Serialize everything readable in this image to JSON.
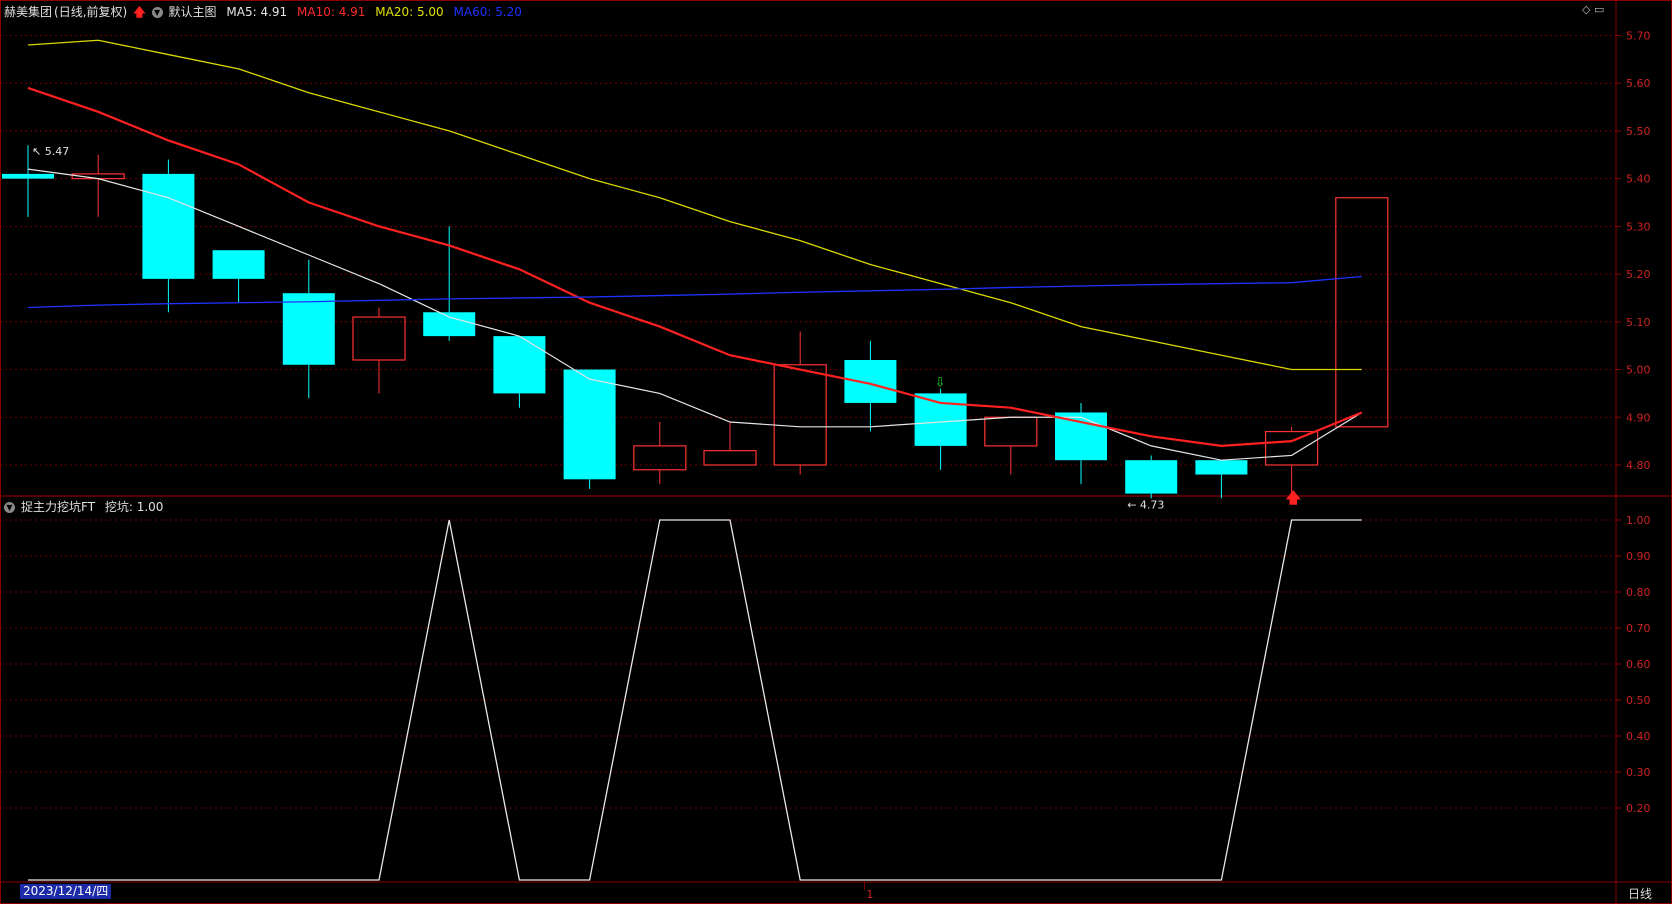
{
  "header": {
    "stock_name": "赫美集团",
    "period_mode": "(日线,前复权)",
    "main_chart_label": "默认主图",
    "ma_labels": [
      {
        "text": "MA5: 4.91",
        "color": "#e6e6e6"
      },
      {
        "text": "MA10: 4.91",
        "color": "#ff2a2a"
      },
      {
        "text": "MA20: 5.00",
        "color": "#e0e000"
      },
      {
        "text": "MA60: 5.20",
        "color": "#1e32ff"
      }
    ]
  },
  "indicator": {
    "title": "捉主力挖坑FT",
    "value_label": "挖坑: 1.00"
  },
  "footer": {
    "date_cursor": "2023/12/14/四",
    "month_marker": "1",
    "period_button": "日线"
  },
  "colors": {
    "up": "#ff3232",
    "down": "#00ffff",
    "grid": "#8b0000",
    "axis_text": "#cc2222",
    "ma5": "#e6e6e6",
    "ma10": "#ff2020",
    "ma20": "#d8d800",
    "ma60": "#1e32ff",
    "indicator_line": "#e8e8e8"
  },
  "chart_data": [
    {
      "type": "candlestick",
      "y_ticks": [
        "5.70",
        "5.60",
        "5.50",
        "5.40",
        "5.30",
        "5.20",
        "5.10",
        "5.00",
        "4.90",
        "4.80"
      ],
      "ylim": [
        4.735,
        5.745
      ],
      "annotations": [
        {
          "text": "5.47",
          "index": 0
        },
        {
          "text": "4.73",
          "index": 16
        }
      ],
      "candles": [
        {
          "open": 5.41,
          "high": 5.47,
          "low": 5.32,
          "close": 5.4
        },
        {
          "open": 5.4,
          "high": 5.45,
          "low": 5.32,
          "close": 5.41
        },
        {
          "open": 5.41,
          "high": 5.44,
          "low": 5.12,
          "close": 5.19
        },
        {
          "open": 5.25,
          "high": 5.25,
          "low": 5.14,
          "close": 5.19
        },
        {
          "open": 5.16,
          "high": 5.23,
          "low": 4.94,
          "close": 5.01
        },
        {
          "open": 5.02,
          "high": 5.13,
          "low": 4.95,
          "close": 5.11
        },
        {
          "open": 5.12,
          "high": 5.3,
          "low": 5.06,
          "close": 5.07
        },
        {
          "open": 5.07,
          "high": 5.07,
          "low": 4.92,
          "close": 4.95
        },
        {
          "open": 5.0,
          "high": 5.0,
          "low": 4.75,
          "close": 4.77
        },
        {
          "open": 4.79,
          "high": 4.89,
          "low": 4.76,
          "close": 4.84
        },
        {
          "open": 4.8,
          "high": 4.89,
          "low": 4.8,
          "close": 4.83
        },
        {
          "open": 4.8,
          "high": 5.08,
          "low": 4.78,
          "close": 5.01
        },
        {
          "open": 5.02,
          "high": 5.06,
          "low": 4.87,
          "close": 4.93
        },
        {
          "open": 4.95,
          "high": 4.96,
          "low": 4.79,
          "close": 4.84
        },
        {
          "open": 4.84,
          "high": 4.9,
          "low": 4.78,
          "close": 4.9
        },
        {
          "open": 4.91,
          "high": 4.93,
          "low": 4.76,
          "close": 4.81
        },
        {
          "open": 4.81,
          "high": 4.82,
          "low": 4.73,
          "close": 4.74
        },
        {
          "open": 4.81,
          "high": 4.81,
          "low": 4.73,
          "close": 4.78
        },
        {
          "open": 4.8,
          "high": 4.88,
          "low": 4.74,
          "close": 4.87
        },
        {
          "open": 4.88,
          "high": 5.36,
          "low": 4.88,
          "close": 5.36
        }
      ],
      "series": [
        {
          "name": "MA5",
          "values": [
            5.42,
            5.4,
            5.36,
            5.3,
            5.24,
            5.18,
            5.11,
            5.07,
            4.98,
            4.95,
            4.89,
            4.88,
            4.88,
            4.89,
            4.9,
            4.9,
            4.84,
            4.81,
            4.82,
            4.91
          ]
        },
        {
          "name": "MA10",
          "values": [
            5.59,
            5.54,
            5.48,
            5.43,
            5.35,
            5.3,
            5.26,
            5.21,
            5.14,
            5.09,
            5.03,
            5.0,
            4.97,
            4.93,
            4.92,
            4.89,
            4.86,
            4.84,
            4.85,
            4.91
          ]
        },
        {
          "name": "MA20",
          "values": [
            5.68,
            5.69,
            5.66,
            5.63,
            5.58,
            5.54,
            5.5,
            5.45,
            5.4,
            5.36,
            5.31,
            5.27,
            5.22,
            5.18,
            5.14,
            5.09,
            5.06,
            5.03,
            5.0,
            5.0
          ]
        },
        {
          "name": "MA60",
          "values": [
            5.13,
            5.135,
            5.138,
            5.14,
            5.142,
            5.145,
            5.148,
            5.15,
            5.152,
            5.155,
            5.158,
            5.162,
            5.165,
            5.168,
            5.172,
            5.175,
            5.178,
            5.18,
            5.182,
            5.195
          ]
        }
      ]
    },
    {
      "type": "line",
      "y_ticks": [
        "1.00",
        "0.90",
        "0.80",
        "0.70",
        "0.60",
        "0.50",
        "0.40",
        "0.30",
        "0.20"
      ],
      "ylim": [
        0,
        1.0
      ],
      "series": [
        {
          "name": "挖坑",
          "values": [
            0,
            0,
            0,
            0,
            0,
            0,
            1,
            0,
            0,
            1,
            1,
            0,
            0,
            0,
            0,
            0,
            0,
            0,
            1,
            1
          ]
        }
      ]
    }
  ]
}
